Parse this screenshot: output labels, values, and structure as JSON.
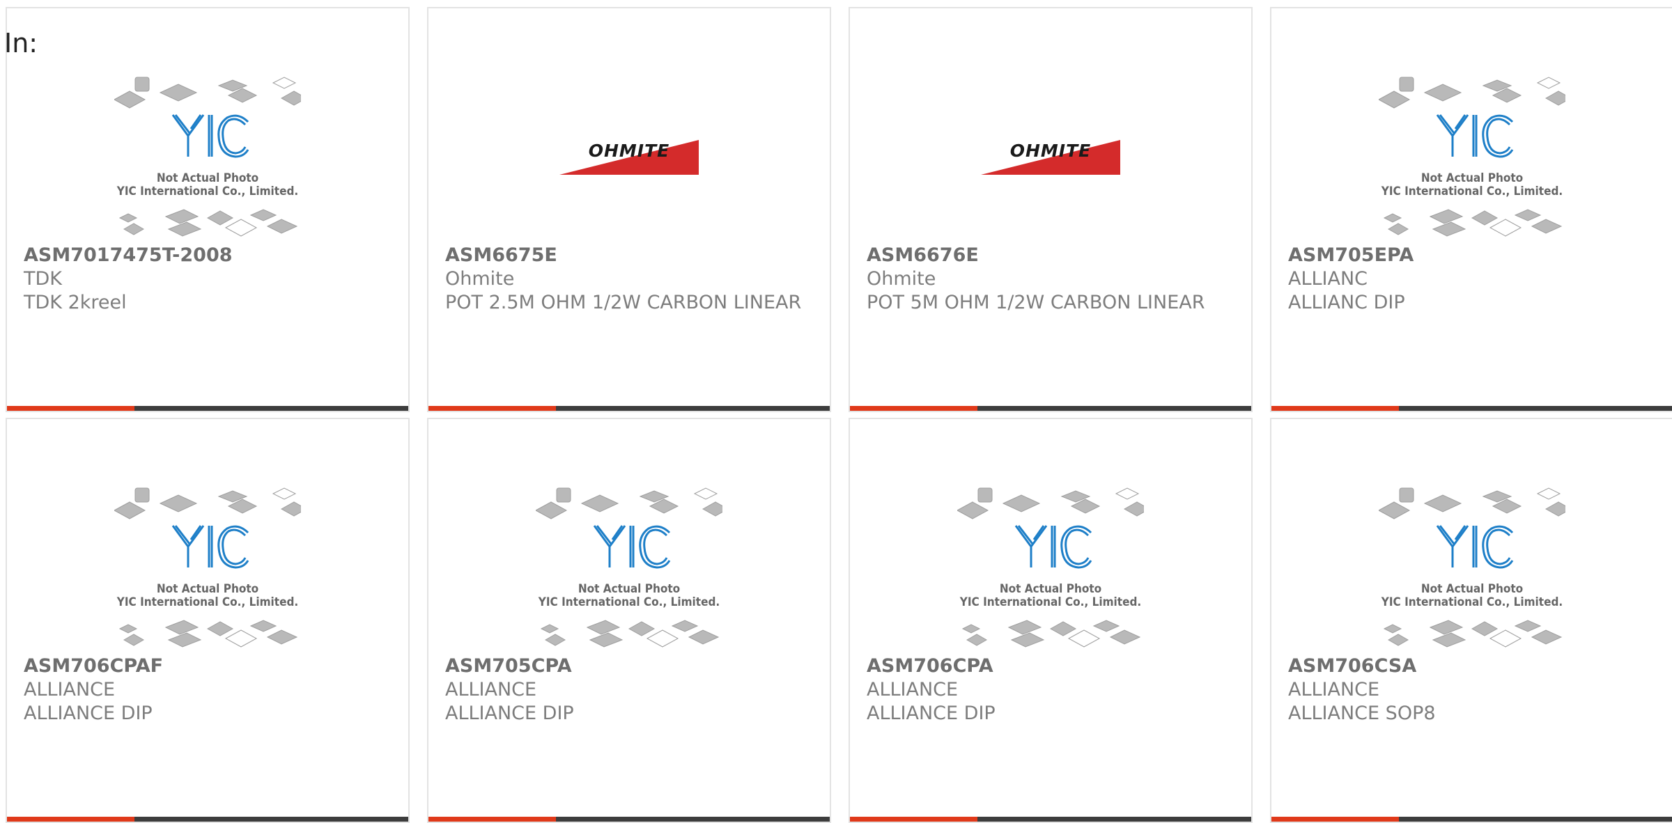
{
  "filter_label": "In:",
  "theme": {
    "accent": "#e0391a",
    "bar": "#3d3d3d",
    "yic_blue": "#1e7fc8",
    "ohmite_red": "#d42b2b"
  },
  "products": [
    {
      "part_number": "ASM7017475T-2008",
      "manufacturer": "TDK",
      "description": "TDK 2kreel",
      "image": "yic-placeholder"
    },
    {
      "part_number": "ASM6675E",
      "manufacturer": "Ohmite",
      "description": "POT 2.5M OHM 1/2W CARBON LINEAR",
      "image": "ohmite-logo"
    },
    {
      "part_number": "ASM6676E",
      "manufacturer": "Ohmite",
      "description": "POT 5M OHM 1/2W CARBON LINEAR",
      "image": "ohmite-logo"
    },
    {
      "part_number": "ASM705EPA",
      "manufacturer": "ALLIANC",
      "description": "ALLIANC DIP",
      "image": "yic-placeholder"
    },
    {
      "part_number": "ASM706CPAF",
      "manufacturer": "ALLIANCE",
      "description": "ALLIANCE DIP",
      "image": "yic-placeholder"
    },
    {
      "part_number": "ASM705CPA",
      "manufacturer": "ALLIANCE",
      "description": "ALLIANCE DIP",
      "image": "yic-placeholder"
    },
    {
      "part_number": "ASM706CPA",
      "manufacturer": "ALLIANCE",
      "description": "ALLIANCE DIP",
      "image": "yic-placeholder"
    },
    {
      "part_number": "ASM706CSA",
      "manufacturer": "ALLIANCE",
      "description": "ALLIANCE SOP8",
      "image": "yic-placeholder"
    }
  ],
  "yic_placeholder": {
    "line1": "Not Actual Photo",
    "line2": "YIC International Co., Limited.",
    "logo_text": "YIC"
  },
  "ohmite_logo_text": "OHMITE"
}
